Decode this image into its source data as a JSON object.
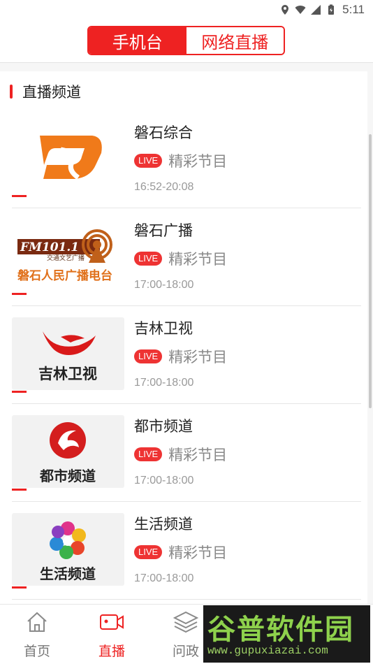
{
  "status_bar": {
    "time": "5:11",
    "icons": [
      "location-icon",
      "wifi-icon",
      "signal-icon",
      "battery-icon"
    ]
  },
  "header": {
    "tabs": [
      {
        "label": "手机台",
        "active": true
      },
      {
        "label": "网络直播",
        "active": false
      }
    ],
    "accent_color": "#ee2222"
  },
  "section": {
    "title": "直播频道"
  },
  "channels": [
    {
      "name": "磐石综合",
      "badge": "LIVE",
      "program": "精彩节目",
      "time": "16:52-20:08",
      "logo": "panshi-s-logo"
    },
    {
      "name": "磐石广播",
      "badge": "LIVE",
      "program": "精彩节目",
      "time": "17:00-18:00",
      "logo": "fm-radio-logo",
      "logo_text": {
        "freq": "FM101.1",
        "sub": "交通文艺广播",
        "name": "磐石人民广播电台"
      }
    },
    {
      "name": "吉林卫视",
      "badge": "LIVE",
      "program": "精彩节目",
      "time": "17:00-18:00",
      "logo": "jilin-tv-logo",
      "logo_text": "吉林卫视"
    },
    {
      "name": "都市频道",
      "badge": "LIVE",
      "program": "精彩节目",
      "time": "17:00-18:00",
      "logo": "dushi-logo",
      "logo_text": "都市频道"
    },
    {
      "name": "生活频道",
      "badge": "LIVE",
      "program": "精彩节目",
      "time": "17:00-18:00",
      "logo": "shenghuo-logo",
      "logo_text": "生活频道"
    }
  ],
  "bottom_nav": [
    {
      "label": "首页",
      "icon": "home-icon",
      "active": false
    },
    {
      "label": "直播",
      "icon": "video-camera-icon",
      "active": true
    },
    {
      "label": "问政",
      "icon": "layers-icon",
      "active": false
    }
  ],
  "watermark": {
    "title": "谷普软件园",
    "url": "www.gupuxiazai.com"
  }
}
